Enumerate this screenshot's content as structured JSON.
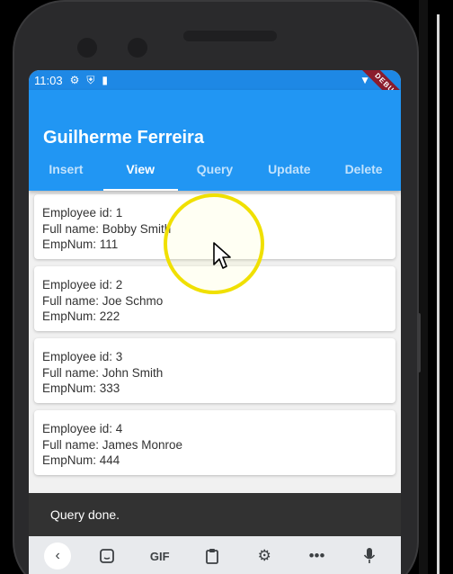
{
  "status_bar": {
    "time": "11:03",
    "icons": [
      "gear-icon",
      "shield-icon",
      "sim-icon",
      "wifi-icon",
      "battery-icon"
    ],
    "ribbon": "DEBUG"
  },
  "app": {
    "title": "Guilherme Ferreira",
    "tabs": [
      {
        "label": "Insert",
        "active": false
      },
      {
        "label": "View",
        "active": true
      },
      {
        "label": "Query",
        "active": false
      },
      {
        "label": "Update",
        "active": false
      },
      {
        "label": "Delete",
        "active": false
      }
    ]
  },
  "employees": [
    {
      "id_line": "Employee id: 1",
      "name_line": "Full name: Bobby Smith",
      "num_line": "EmpNum: 111"
    },
    {
      "id_line": "Employee id: 2",
      "name_line": "Full name: Joe Schmo",
      "num_line": "EmpNum: 222"
    },
    {
      "id_line": "Employee id: 3",
      "name_line": "Full name: John Smith",
      "num_line": "EmpNum: 333"
    },
    {
      "id_line": "Employee id: 4",
      "name_line": "Full name: James Monroe",
      "num_line": "EmpNum: 444"
    }
  ],
  "snackbar": {
    "message": "Query done."
  },
  "keyboard_toolbar": {
    "items": [
      "back-icon",
      "sticker-icon",
      "GIF",
      "clipboard-icon",
      "gear-icon",
      "more-icon",
      "mic-icon"
    ],
    "gif_label": "GIF"
  },
  "colors": {
    "appbar": "#2196f3",
    "statusbar": "#1e88e5",
    "snackbar": "#323232",
    "highlight": "#f0e000"
  }
}
